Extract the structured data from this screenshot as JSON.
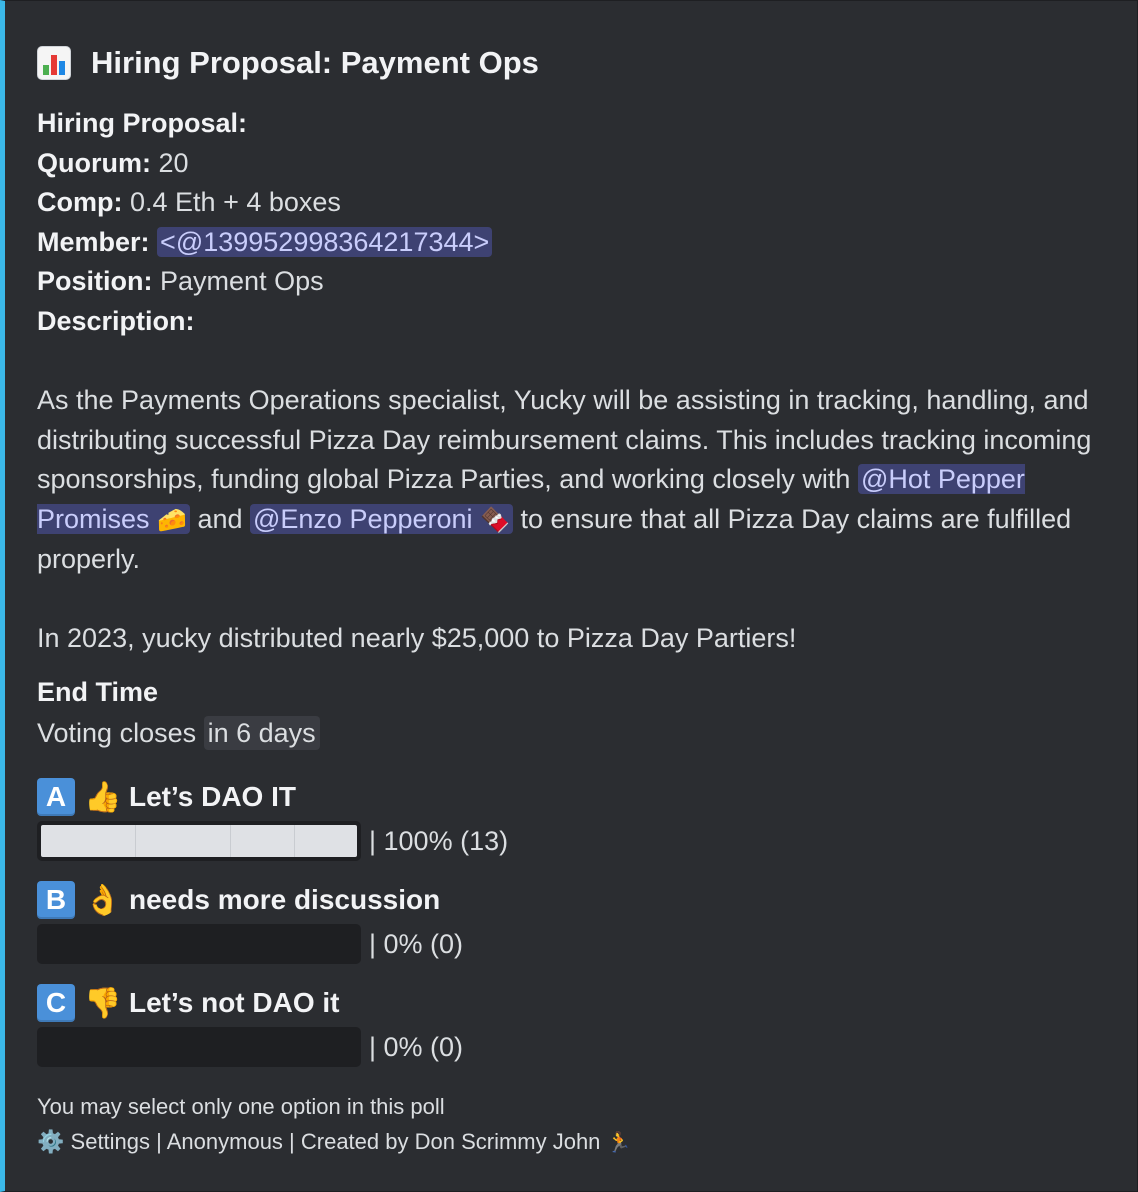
{
  "poll": {
    "title": "Hiring Proposal: Payment Ops",
    "title_icon": "bar-chart-icon",
    "fields": {
      "heading": "Hiring Proposal:",
      "quorum_label": "Quorum:",
      "quorum_value": "20",
      "comp_label": "Comp:",
      "comp_value": "0.4 Eth + 4 boxes",
      "member_label": "Member:",
      "member_value": "<@1399529983642173​44>",
      "position_label": "Position:",
      "position_value": "Payment Ops",
      "description_label": "Description:"
    },
    "description": {
      "p1_a": "As the Payments Operations specialist, Yucky will be assisting in tracking, handling, and distributing successful Pizza Day reimbursement claims. This includes tracking incoming sponsorships, funding global Pizza Parties, and working closely with ",
      "mention_1": "@Hot Pepper Promises",
      "mention_1_emoji": "🧀",
      "p1_b": " and ",
      "mention_2": "@Enzo Pepperoni",
      "mention_2_emoji": "🍫",
      "p1_c": " to ensure that all Pizza Day claims are fulfilled properly.",
      "p2": "In 2023, yucky distributed nearly $25,000 to Pizza Day Partiers!"
    },
    "end_time": {
      "label": "End Time",
      "prefix": "Voting closes ",
      "relative": "in 6 days"
    },
    "options": [
      {
        "letter": "A",
        "emoji": "👍",
        "label": "Let’s DAO IT",
        "result": "| 100% (13)",
        "fraction": 1.0
      },
      {
        "letter": "B",
        "emoji": "👌",
        "label": "needs more discussion",
        "result": "| 0% (0)",
        "fraction": 0.0
      },
      {
        "letter": "C",
        "emoji": "👎",
        "label": "Let’s not DAO it",
        "result": "| 0% (0)",
        "fraction": 0.0
      }
    ],
    "footer": {
      "line1": "You may select only one option in this poll",
      "settings_icon": "⚙️",
      "line2": "Settings | Anonymous | Created by Don Scrimmy John",
      "runner_icon": "🏃"
    },
    "colors": {
      "background": "#2b2d31",
      "accent_border": "#3bb8e8",
      "mention_bg": "#3e4272",
      "mention_text": "#c9cdfb",
      "letter_bg": "#4a90d9",
      "bar_fill": "#dfe1e5",
      "bar_track": "#1e1f22"
    }
  }
}
